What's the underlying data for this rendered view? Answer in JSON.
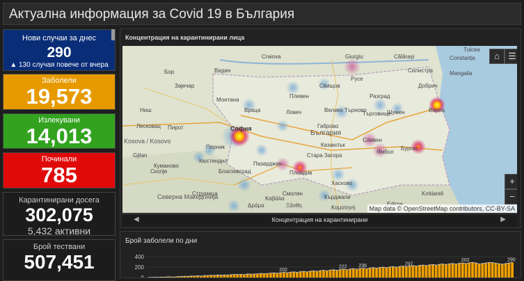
{
  "header": {
    "title": "Актуална информация за Covid 19 в България"
  },
  "cards": {
    "new_cases": {
      "label": "Нови случаи за днес",
      "value": "290",
      "sub": "▲ 130 случая повече от вчера",
      "color": "#0a2d78"
    },
    "infected": {
      "label": "Заболели",
      "value": "19,573",
      "color": "#e69a00"
    },
    "recovered": {
      "label": "Излекувани",
      "value": "14,013",
      "color": "#33a31f"
    },
    "deceased": {
      "label": "Починали",
      "value": "785",
      "color": "#e00a0a"
    },
    "quarantined": {
      "label": "Карантинирани досега",
      "value": "302,075",
      "sub": "5,432 активни"
    },
    "tests": {
      "label": "Брой тествани",
      "value": "507,451"
    }
  },
  "map_panel": {
    "title": "Концентрация на карантинирани лица",
    "attribution": "Map data © OpenStreetMap contributors, CC-BY-SA",
    "carousel_label": "Концентрация на карантинирани",
    "home_icon": "home-icon",
    "list_icon": "list-icon",
    "zoom_in": "+",
    "zoom_out": "−",
    "labels": {
      "bulgaria": "България",
      "sofia": "София",
      "kosovo": "Kosova / Kosovo",
      "n_macedonia": "Северна Македонија",
      "ruse": "Русе",
      "varna": "Варна",
      "burgas": "Бургас",
      "plovdiv": "Пловдив",
      "stara_zagora": "Стара Загора",
      "pleven": "Плевен",
      "vidin": "Видин",
      "vratsa": "Враца",
      "montana": "Монтана",
      "lovech": "Ловеч",
      "veliko_tarnovo": "Велико Търново",
      "shumen": "Шумен",
      "silistra": "Силистра",
      "dobrich": "Добрич",
      "haskovo": "Хасково",
      "kardzhali": "Кърджали",
      "smolyan": "Смолян",
      "blagoevgrad": "Благоевград",
      "pazardzhik": "Пазарджик",
      "kyustendil": "Кюстендил",
      "sliven": "Сливен",
      "yambol": "Ямбол",
      "gabrovo": "Габрово",
      "targovishte": "Търговище",
      "razgrad": "Разград",
      "pernik": "Перник",
      "kazanlak": "Казанлък",
      "svishtov": "Свищов",
      "skopje": "Скопје",
      "nis": "Ниш",
      "pirot": "Пирот",
      "leskovac": "Лесковац",
      "kumanovo": "Куманово",
      "craiova": "Craiova",
      "zajecar": "Зајечар",
      "bor": "Бор",
      "kavala": "Καβάλα",
      "drama": "Δράμα",
      "xanthi": "Ξάνθη",
      "komotini": "Κομοτηνή",
      "edirne": "Edirne",
      "kirklareli": "Kırklareli",
      "constanta": "Constanța",
      "tulcea": "Tulcea",
      "mangalia": "Mangalia",
      "giurgiu": "Giurgiu",
      "calarasi": "Călărași",
      "gjilan": "Gjilan",
      "strumica": "Струмица"
    }
  },
  "chart_panel": {
    "title": "Брой заболели по дни",
    "colors": {
      "bar": "#f0a000",
      "line": "#cccccc"
    }
  },
  "chart_data": {
    "type": "bar",
    "title": "Брой заболели по дни",
    "ylim": [
      0,
      400
    ],
    "yticks": [
      0,
      200,
      400
    ],
    "series": [
      {
        "values": [
          4,
          3,
          7,
          5,
          10,
          8,
          15,
          9,
          12,
          20,
          18,
          25,
          22,
          30,
          28,
          35,
          26,
          40,
          38,
          45,
          42,
          50,
          44,
          52,
          48,
          55,
          60,
          58,
          62,
          55,
          70,
          65,
          68,
          72,
          80,
          75,
          78,
          85,
          90,
          82,
          95,
          100,
          92,
          105,
          110,
          98,
          115,
          120,
          108,
          125,
          130,
          118,
          135,
          140,
          128,
          145,
          150,
          138,
          155,
          160,
          148,
          165,
          170,
          158,
          175,
          180,
          168,
          185,
          190,
          178,
          195,
          200,
          188,
          205,
          210,
          198,
          215,
          220,
          208,
          225,
          230,
          218,
          235,
          240,
          228,
          245,
          250,
          238,
          255,
          260,
          248,
          265,
          270,
          258,
          275,
          280,
          268,
          285,
          290,
          278,
          260,
          270,
          280,
          290,
          286,
          275,
          265,
          255,
          270,
          280,
          290
        ]
      }
    ],
    "labels": [
      {
        "index": 40,
        "text": "202"
      },
      {
        "index": 58,
        "text": "222"
      },
      {
        "index": 64,
        "text": "236"
      },
      {
        "index": 78,
        "text": "297"
      },
      {
        "index": 95,
        "text": "202"
      },
      {
        "index": 110,
        "text": "290"
      }
    ]
  }
}
